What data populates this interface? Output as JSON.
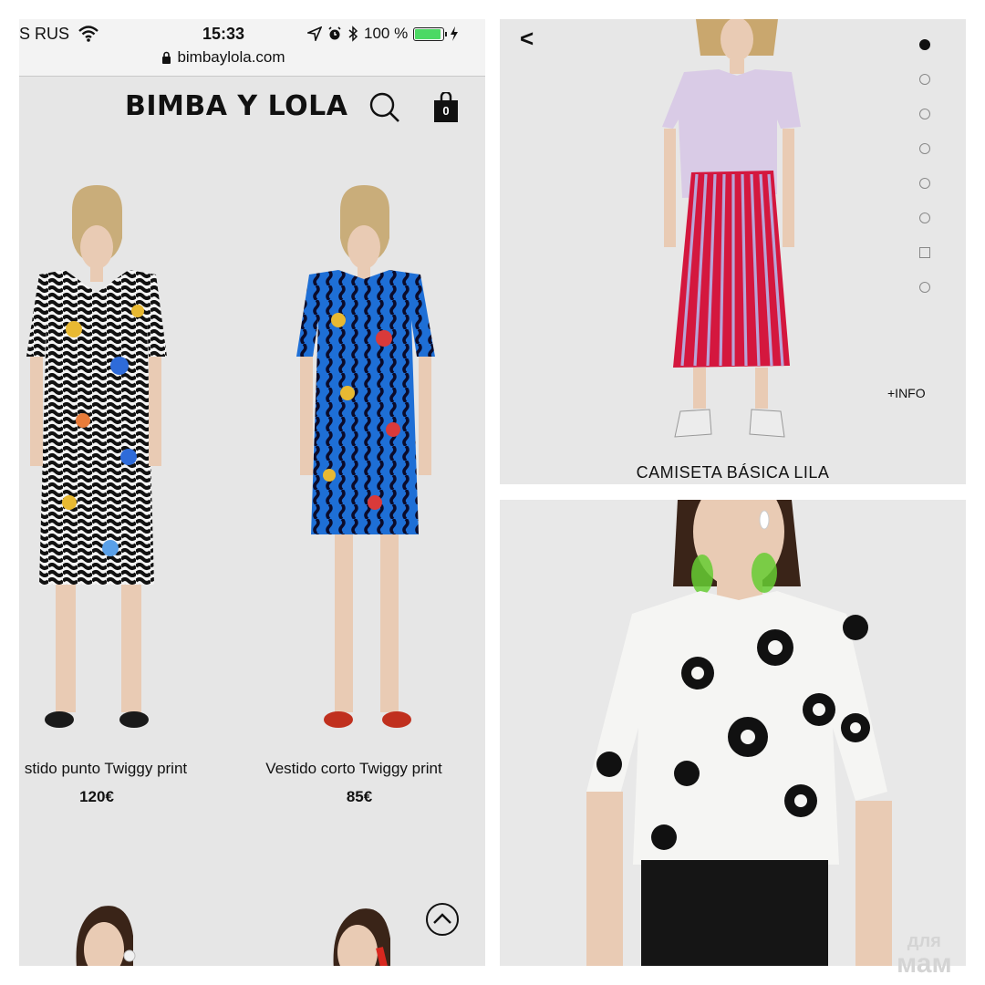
{
  "status_bar": {
    "carrier": "S RUS",
    "time": "15:33",
    "battery": "100 %",
    "battery_level": 100,
    "url": "bimbaylola.com"
  },
  "site": {
    "logo": "BIMBA Y LOLA",
    "cart_count": "0"
  },
  "products": [
    {
      "name": "stido punto Twiggy print",
      "price": "120€"
    },
    {
      "name": "Vestido corto Twiggy print",
      "price": "85€"
    }
  ],
  "detail": {
    "back": "<",
    "info": "+INFO",
    "title": "CAMISETA BÁSICA LILA",
    "gallery": [
      "active",
      "dot",
      "dot",
      "dot",
      "dot",
      "dot",
      "square",
      "dot"
    ]
  },
  "watermark": {
    "line1": "для",
    "line2": "мам"
  },
  "colors": {
    "panel": "#e6e6e6",
    "battery": "#4cd964",
    "skirt_red": "#d4173e",
    "tee_lilac": "#d9cbe6"
  }
}
